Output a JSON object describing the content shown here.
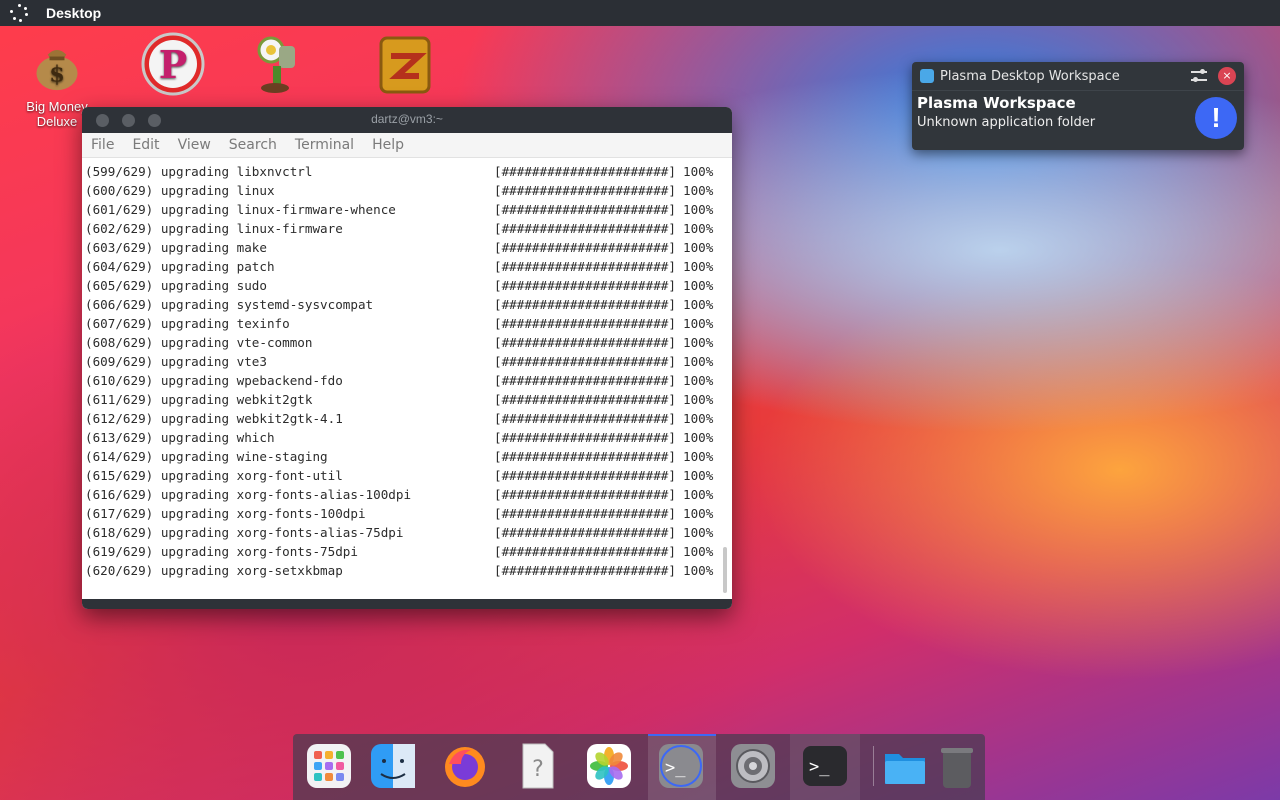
{
  "panel": {
    "title": "Desktop",
    "launcher_icon": "kickoff-dots-icon"
  },
  "desktop_icons": [
    {
      "name": "money-bag-icon",
      "label_line1": "Big Money",
      "label_line2": "Deluxe"
    },
    {
      "name": "pinball-p-icon",
      "label_line1": "",
      "label_line2": ""
    },
    {
      "name": "plants-vs-zombies-icon",
      "label_line1": "",
      "label_line2": ""
    },
    {
      "name": "zuma-icon",
      "label_line1": "",
      "label_line2": ""
    }
  ],
  "terminal": {
    "title": "dartz@vm3:~",
    "menu": [
      "File",
      "Edit",
      "View",
      "Search",
      "Terminal",
      "Help"
    ],
    "lines": [
      {
        "counter": "(599/629)",
        "action": "upgrading",
        "package": "libxnvctrl",
        "bar": "[######################]",
        "percent": "100%"
      },
      {
        "counter": "(600/629)",
        "action": "upgrading",
        "package": "linux",
        "bar": "[######################]",
        "percent": "100%"
      },
      {
        "counter": "(601/629)",
        "action": "upgrading",
        "package": "linux-firmware-whence",
        "bar": "[######################]",
        "percent": "100%"
      },
      {
        "counter": "(602/629)",
        "action": "upgrading",
        "package": "linux-firmware",
        "bar": "[######################]",
        "percent": "100%"
      },
      {
        "counter": "(603/629)",
        "action": "upgrading",
        "package": "make",
        "bar": "[######################]",
        "percent": "100%"
      },
      {
        "counter": "(604/629)",
        "action": "upgrading",
        "package": "patch",
        "bar": "[######################]",
        "percent": "100%"
      },
      {
        "counter": "(605/629)",
        "action": "upgrading",
        "package": "sudo",
        "bar": "[######################]",
        "percent": "100%"
      },
      {
        "counter": "(606/629)",
        "action": "upgrading",
        "package": "systemd-sysvcompat",
        "bar": "[######################]",
        "percent": "100%"
      },
      {
        "counter": "(607/629)",
        "action": "upgrading",
        "package": "texinfo",
        "bar": "[######################]",
        "percent": "100%"
      },
      {
        "counter": "(608/629)",
        "action": "upgrading",
        "package": "vte-common",
        "bar": "[######################]",
        "percent": "100%"
      },
      {
        "counter": "(609/629)",
        "action": "upgrading",
        "package": "vte3",
        "bar": "[######################]",
        "percent": "100%"
      },
      {
        "counter": "(610/629)",
        "action": "upgrading",
        "package": "wpebackend-fdo",
        "bar": "[######################]",
        "percent": "100%"
      },
      {
        "counter": "(611/629)",
        "action": "upgrading",
        "package": "webkit2gtk",
        "bar": "[######################]",
        "percent": "100%"
      },
      {
        "counter": "(612/629)",
        "action": "upgrading",
        "package": "webkit2gtk-4.1",
        "bar": "[######################]",
        "percent": "100%"
      },
      {
        "counter": "(613/629)",
        "action": "upgrading",
        "package": "which",
        "bar": "[######################]",
        "percent": "100%"
      },
      {
        "counter": "(614/629)",
        "action": "upgrading",
        "package": "wine-staging",
        "bar": "[######################]",
        "percent": "100%"
      },
      {
        "counter": "(615/629)",
        "action": "upgrading",
        "package": "xorg-font-util",
        "bar": "[######################]",
        "percent": "100%"
      },
      {
        "counter": "(616/629)",
        "action": "upgrading",
        "package": "xorg-fonts-alias-100dpi",
        "bar": "[######################]",
        "percent": "100%"
      },
      {
        "counter": "(617/629)",
        "action": "upgrading",
        "package": "xorg-fonts-100dpi",
        "bar": "[######################]",
        "percent": "100%"
      },
      {
        "counter": "(618/629)",
        "action": "upgrading",
        "package": "xorg-fonts-alias-75dpi",
        "bar": "[######################]",
        "percent": "100%"
      },
      {
        "counter": "(619/629)",
        "action": "upgrading",
        "package": "xorg-fonts-75dpi",
        "bar": "[######################]",
        "percent": "100%"
      },
      {
        "counter": "(620/629)",
        "action": "upgrading",
        "package": "xorg-setxkbmap",
        "bar": "[######################]",
        "percent": "100%"
      }
    ]
  },
  "notification": {
    "app_name": "Plasma Desktop Workspace",
    "title": "Plasma Workspace",
    "message": "Unknown application folder",
    "close_glyph": "×",
    "alert_glyph": "!",
    "accent_color": "#3d68f5"
  },
  "dock": {
    "items": [
      "launchpad-icon",
      "finder-icon",
      "firefox-icon",
      "unknown-file-icon",
      "photos-icon",
      "terminal-active-icon",
      "system-settings-icon",
      "terminal-icon",
      "folder-icon",
      "trash-icon"
    ],
    "terminal_glyph": ">_"
  }
}
